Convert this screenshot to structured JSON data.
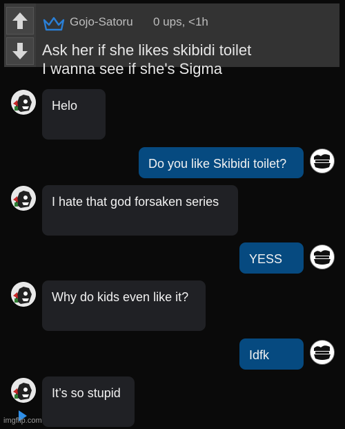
{
  "comment": {
    "username": "Gojo-Satoru",
    "meta": "0 ups, <1h",
    "lines": [
      "Ask her if she likes skibidi toilet",
      "I wanna see if she's Sigma"
    ],
    "crown_color": "#2a7fd6"
  },
  "chat": {
    "messages": [
      {
        "from": "them",
        "text": "Helo"
      },
      {
        "from": "me",
        "text": "Do you like Skibidi toilet?"
      },
      {
        "from": "them",
        "text": "I hate that god forsaken series"
      },
      {
        "from": "me",
        "text": "YESS"
      },
      {
        "from": "them",
        "text": "Why do kids even like it?"
      },
      {
        "from": "me",
        "text": "Idfk"
      },
      {
        "from": "them",
        "text": "It’s so stupid"
      }
    ],
    "incoming_color": "#202125",
    "outgoing_color": "#064a80"
  },
  "watermark": "imgflip.com"
}
